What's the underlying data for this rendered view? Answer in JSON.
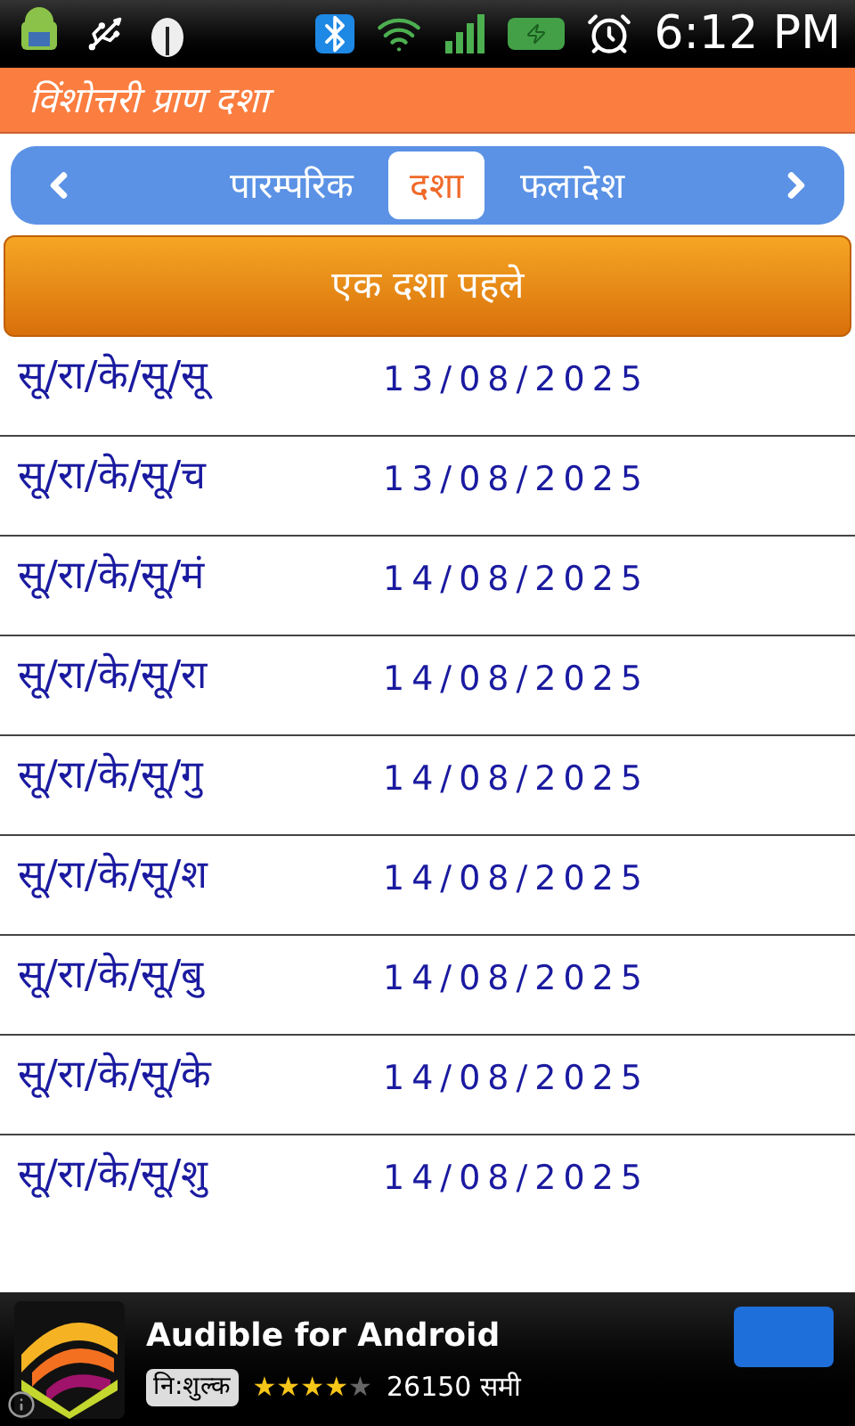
{
  "status_bar": {
    "time": "6:12 PM"
  },
  "header": {
    "title": "विंशोत्तरी प्राण दशा"
  },
  "tabs": [
    {
      "label": "पारम्परिक",
      "selected": false
    },
    {
      "label": "दशा",
      "selected": true
    },
    {
      "label": "फलादेश",
      "selected": false
    }
  ],
  "previous_button": {
    "label": "एक दशा पहले"
  },
  "rows": [
    {
      "name": "सू/रा/के/सू/सू",
      "date": "13/08/2025"
    },
    {
      "name": "सू/रा/के/सू/च",
      "date": "13/08/2025"
    },
    {
      "name": "सू/रा/के/सू/मं",
      "date": "14/08/2025"
    },
    {
      "name": "सू/रा/के/सू/रा",
      "date": "14/08/2025"
    },
    {
      "name": "सू/रा/के/सू/गु",
      "date": "14/08/2025"
    },
    {
      "name": "सू/रा/के/सू/श",
      "date": "14/08/2025"
    },
    {
      "name": "सू/रा/के/सू/बु",
      "date": "14/08/2025"
    },
    {
      "name": "सू/रा/के/सू/के",
      "date": "14/08/2025"
    },
    {
      "name": "सू/रा/के/सू/शु",
      "date": "14/08/2025"
    }
  ],
  "ad": {
    "title": "Audible for Android",
    "price": "नि:शुल्क",
    "stars": 4,
    "reviews": "26150 समी"
  }
}
